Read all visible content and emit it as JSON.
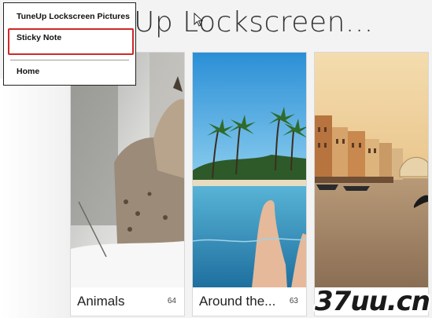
{
  "page": {
    "title": "Up Lockscreen..."
  },
  "menu": {
    "items": [
      {
        "label": "TuneUp Lockscreen Pictures"
      },
      {
        "label": "Sticky Note"
      },
      {
        "label": "Home"
      }
    ]
  },
  "tiles": [
    {
      "label": "Animals",
      "count": "64"
    },
    {
      "label": "Around the...",
      "count": "63"
    },
    {
      "label": "",
      "count": ""
    }
  ],
  "watermark": {
    "text": "37uu.cn"
  },
  "colors": {
    "highlight": "#d02828",
    "sky": "#4aa8e0",
    "sea": "#2f87b8"
  }
}
